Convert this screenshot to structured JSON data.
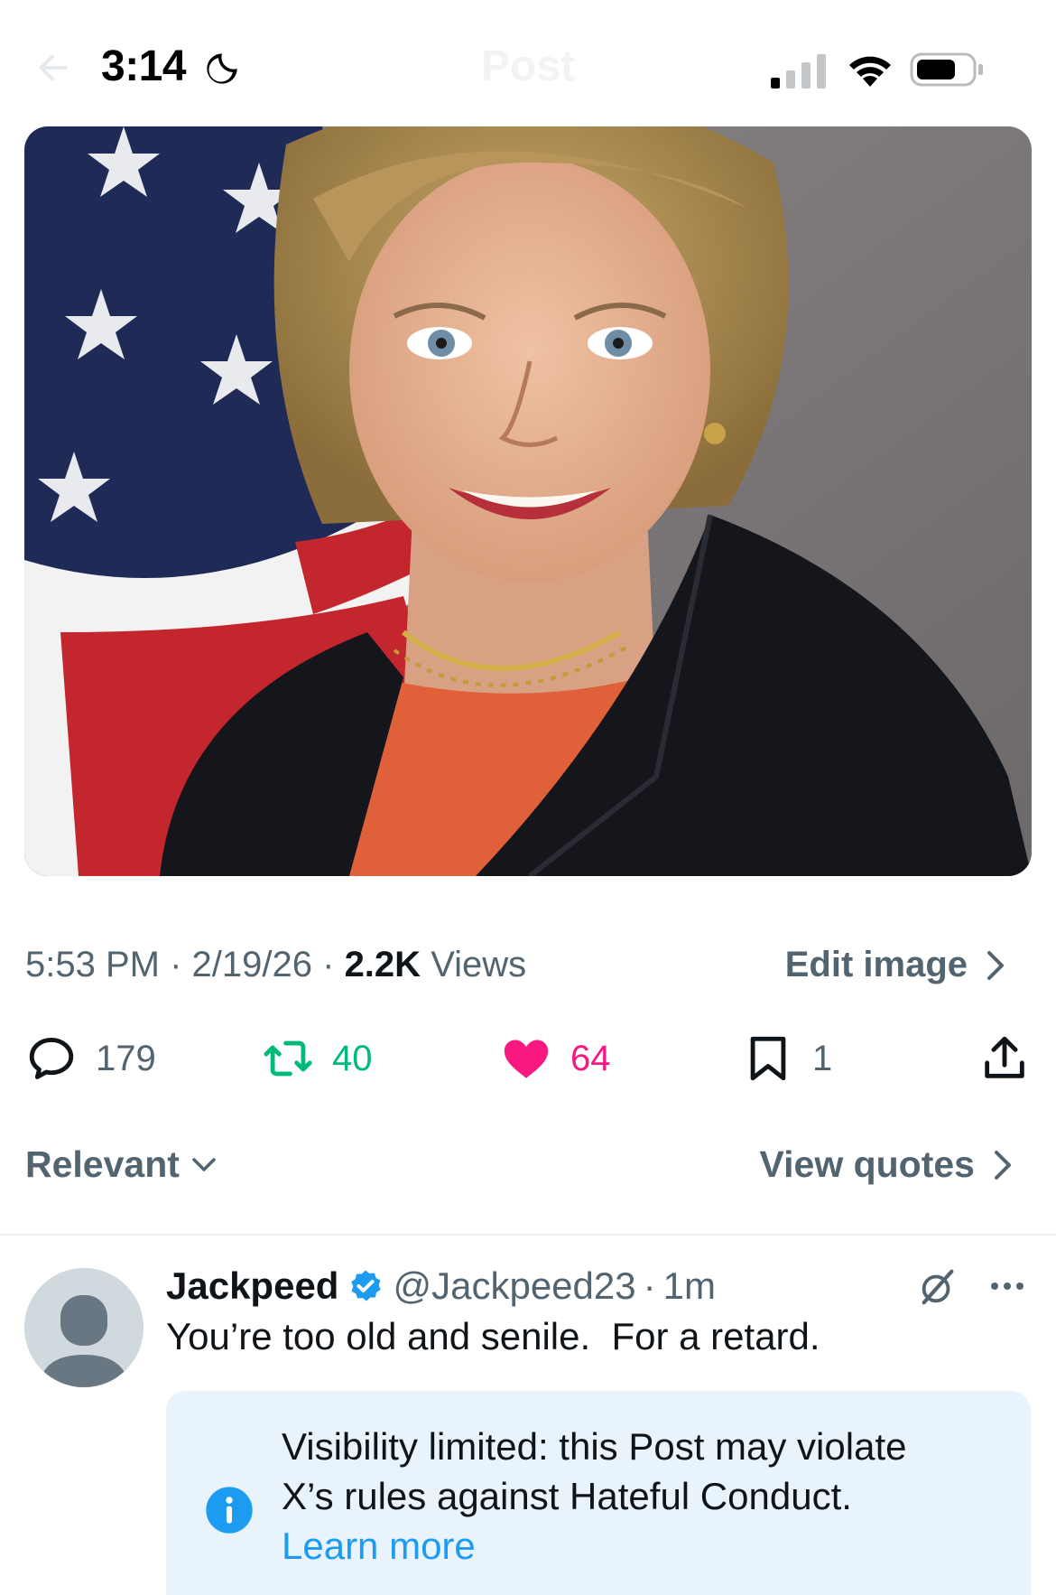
{
  "status_bar": {
    "time": "3:14",
    "ghost_title": "Post"
  },
  "post": {
    "time": "5:53 PM",
    "date": "2/19/26",
    "views_count": "2.2K",
    "views_label": "Views",
    "edit_image_label": "Edit image",
    "actions": {
      "replies": "179",
      "reposts": "40",
      "likes": "64",
      "bookmarks": "1"
    }
  },
  "sort": {
    "relevant_label": "Relevant",
    "view_quotes_label": "View quotes"
  },
  "reply": {
    "name": "Jackpeed",
    "handle": "@Jackpeed23",
    "time": "1m",
    "text": "You’re too old and senile.  For a retard.",
    "notice_line1": "Visibility limited: this Post may violate",
    "notice_line2": "X’s rules against Hateful Conduct.",
    "learn_more": "Learn more"
  },
  "colors": {
    "secondary_text": "#536471",
    "repost_green": "#00ba7c",
    "like_pink": "#f91880",
    "link_blue": "#1d9bf0",
    "notice_bg": "#e8f3fb",
    "verified_blue": "#1d9bf0"
  },
  "icons": [
    "back-arrow-icon",
    "moon-icon",
    "signal-icon",
    "wifi-icon",
    "battery-icon",
    "reply-icon",
    "repost-icon",
    "heart-icon",
    "bookmark-icon",
    "share-icon",
    "chevron-right-icon",
    "chevron-down-icon",
    "verified-icon",
    "grok-icon",
    "more-icon",
    "info-icon"
  ]
}
